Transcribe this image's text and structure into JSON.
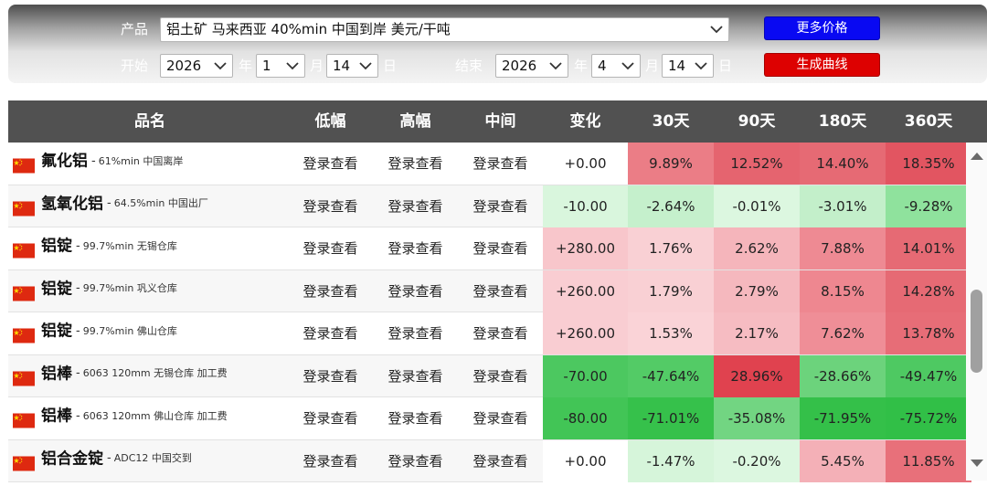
{
  "controls": {
    "product_label": "产品",
    "product_value": "铝土矿 马来西亚 40%min 中国到岸 美元/干吨",
    "start_label": "开始",
    "end_label": "结束",
    "start": {
      "year": "2026",
      "month": "1",
      "day": "14"
    },
    "end": {
      "year": "2026",
      "month": "4",
      "day": "14"
    },
    "year_unit": "年",
    "month_unit": "月",
    "day_unit": "日",
    "more_prices_button": "更多价格",
    "generate_chart_button": "生成曲线"
  },
  "table": {
    "headers": [
      "品名",
      "低幅",
      "高幅",
      "中间",
      "变化",
      "30天",
      "90天",
      "180天",
      "360天"
    ],
    "rows": [
      {
        "name": "氟化铝",
        "desc": "61%min 中国离岸",
        "low": "登录查看",
        "high": "登录查看",
        "mid": "登录查看",
        "change": "+0.00",
        "d30": "9.89%",
        "d90": "12.52%",
        "d180": "14.40%",
        "d360": "18.35%"
      },
      {
        "name": "氢氧化铝",
        "desc": "64.5%min 中国出厂",
        "low": "登录查看",
        "high": "登录查看",
        "mid": "登录查看",
        "change": "-10.00",
        "d30": "-2.64%",
        "d90": "-0.01%",
        "d180": "-3.01%",
        "d360": "-9.28%"
      },
      {
        "name": "铝锭",
        "desc": "99.7%min 无锡仓库",
        "low": "登录查看",
        "high": "登录查看",
        "mid": "登录查看",
        "change": "+280.00",
        "d30": "1.76%",
        "d90": "2.62%",
        "d180": "7.88%",
        "d360": "14.01%"
      },
      {
        "name": "铝锭",
        "desc": "99.7%min 巩义仓库",
        "low": "登录查看",
        "high": "登录查看",
        "mid": "登录查看",
        "change": "+260.00",
        "d30": "1.79%",
        "d90": "2.79%",
        "d180": "8.15%",
        "d360": "14.28%"
      },
      {
        "name": "铝锭",
        "desc": "99.7%min 佛山仓库",
        "low": "登录查看",
        "high": "登录查看",
        "mid": "登录查看",
        "change": "+260.00",
        "d30": "1.53%",
        "d90": "2.17%",
        "d180": "7.62%",
        "d360": "13.78%"
      },
      {
        "name": "铝棒",
        "desc": "6063 120mm 无锡仓库 加工费",
        "low": "登录查看",
        "high": "登录查看",
        "mid": "登录查看",
        "change": "-70.00",
        "d30": "-47.64%",
        "d90": "28.96%",
        "d180": "-28.66%",
        "d360": "-49.47%"
      },
      {
        "name": "铝棒",
        "desc": "6063 120mm 佛山仓库 加工费",
        "low": "登录查看",
        "high": "登录查看",
        "mid": "登录查看",
        "change": "-80.00",
        "d30": "-71.01%",
        "d90": "-35.08%",
        "d180": "-71.95%",
        "d360": "-75.72%"
      },
      {
        "name": "铝合金锭",
        "desc": "ADC12 中国交到",
        "low": "登录查看",
        "high": "登录查看",
        "mid": "登录查看",
        "change": "+0.00",
        "d30": "-1.47%",
        "d90": "-0.20%",
        "d180": "5.45%",
        "d360": "11.85%"
      }
    ],
    "cell_colors": [
      {
        "change": "#ffffff",
        "d30": "#eb7d86",
        "d90": "#e5646f",
        "d180": "#e66a74",
        "d360": "#e25561"
      },
      {
        "change": "#d9f6dd",
        "d30": "#c5f0cc",
        "d90": "#dcf7e0",
        "d180": "#c3efca",
        "d360": "#8fe29d"
      },
      {
        "change": "#f8c6cb",
        "d30": "#f9d0d4",
        "d90": "#f5b5bb",
        "d180": "#ee8a93",
        "d360": "#e66a74"
      },
      {
        "change": "#f9cdd2",
        "d30": "#f9d0d4",
        "d90": "#f5b8be",
        "d180": "#ee8790",
        "d360": "#e66a74"
      },
      {
        "change": "#f9cdd2",
        "d30": "#fad3d7",
        "d90": "#f6bcc2",
        "d180": "#ef8e97",
        "d360": "#e76d77"
      },
      {
        "change": "#4cc860",
        "d30": "#53cb66",
        "d90": "#e0424f",
        "d180": "#6cd37c",
        "d360": "#4ec962"
      },
      {
        "change": "#42c556",
        "d30": "#36c14b",
        "d90": "#72d582",
        "d180": "#34c049",
        "d360": "#31bf47"
      },
      {
        "change": "#ffffff",
        "d30": "#d6f5da",
        "d90": "#dcf7e0",
        "d180": "#f4b0b7",
        "d360": "#e8707a"
      }
    ]
  },
  "icons": {
    "flag": "china-flag-icon",
    "dropdown": "chevron-down-icon",
    "scroll_up": "scroll-up-arrow-icon",
    "scroll_down": "scroll-down-arrow-icon"
  }
}
